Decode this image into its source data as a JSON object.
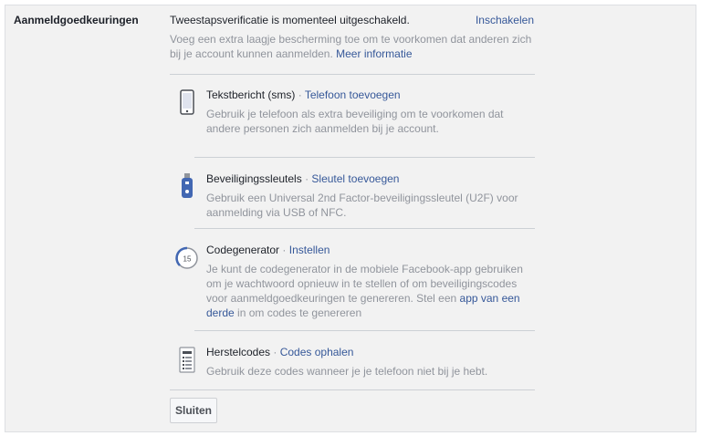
{
  "section": {
    "label": "Aanmeldgoedkeuringen",
    "status": "Tweestapsverificatie is momenteel uitgeschakeld.",
    "enable_link": "Inschakelen",
    "intro": "Voeg een extra laagje bescherming toe om te voorkomen dat anderen zich bij je account kunnen aanmelden.",
    "more_info_link": "Meer informatie"
  },
  "options": [
    {
      "icon": "phone-icon",
      "title": "Tekstbericht (sms)",
      "separator": " · ",
      "action": "Telefoon toevoegen",
      "description": "Gebruik je telefoon als extra beveiliging om te voorkomen dat andere personen zich aanmelden bij je account."
    },
    {
      "icon": "usb-key-icon",
      "title": "Beveiligingssleutels",
      "separator": " · ",
      "action": "Sleutel toevoegen",
      "description": "Gebruik een Universal 2nd Factor-beveiligingssleutel (U2F) voor aanmelding via USB of NFC."
    },
    {
      "icon": "code-generator-icon",
      "icon_text": "15",
      "title": "Codegenerator",
      "separator": " · ",
      "action": "Instellen",
      "description_pre": "Je kunt de codegenerator in de mobiele Facebook-app gebruiken om je wachtwoord opnieuw in te stellen of om beveiligingscodes voor aanmeldgoedkeuringen te genereren. Stel een ",
      "description_link": "app van een derde",
      "description_post": " in om codes te genereren"
    },
    {
      "icon": "recovery-codes-icon",
      "title": "Herstelcodes",
      "separator": " · ",
      "action": "Codes ophalen",
      "description": "Gebruik deze codes wanneer je je telefoon niet bij je hebt."
    }
  ],
  "footer": {
    "close_label": "Sluiten"
  },
  "colors": {
    "link": "#365899",
    "muted": "#90949c",
    "panel": "#f2f2f2"
  }
}
